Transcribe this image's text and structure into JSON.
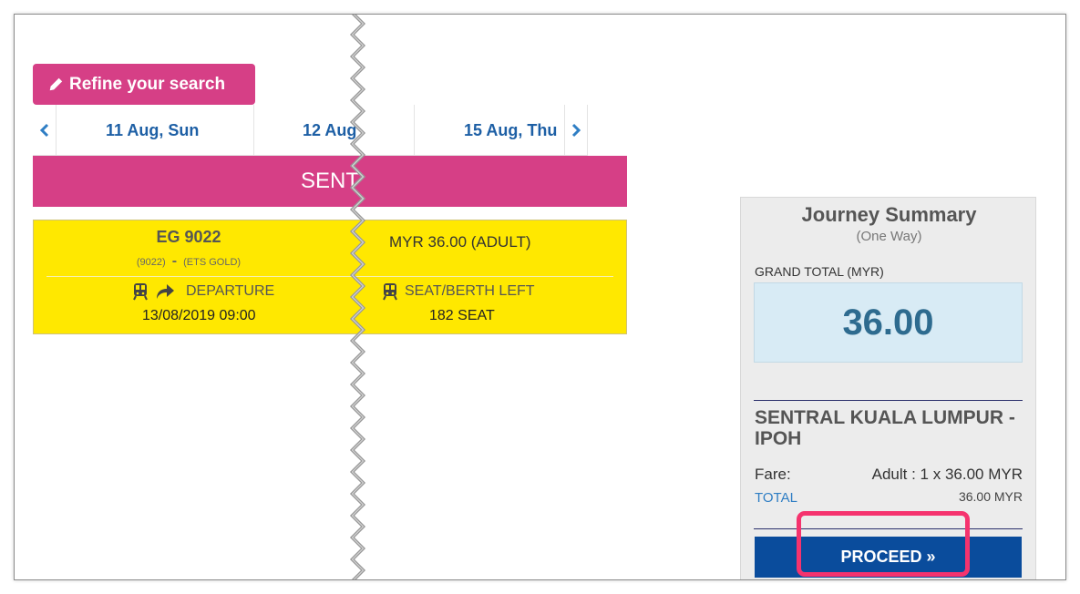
{
  "toolbar": {
    "refine_label": "Refine your search"
  },
  "date_nav": {
    "prev_icon": "chevron-left-icon",
    "next_icon": "chevron-right-icon",
    "dates": [
      "11 Aug, Sun",
      "12 Aug",
      "15 Aug, Thu"
    ]
  },
  "route_header": {
    "station": "SENT"
  },
  "train": {
    "code": "EG 9022",
    "number": "(9022)",
    "dash": "-",
    "class": "(ETS GOLD)",
    "price": "MYR 36.00 (ADULT)",
    "departure_label": "DEPARTURE",
    "departure_value": "13/08/2019 09:00",
    "seat_label": "SEAT/BERTH LEFT",
    "seat_value": "182 SEAT",
    "train_icon": "train-icon",
    "arrow_icon": "share-arrow-icon"
  },
  "summary": {
    "title": "Journey Summary",
    "subtitle": "(One Way)",
    "grand_total_label": "GRAND TOTAL (MYR)",
    "grand_total_value": "36.00",
    "route": "SENTRAL KUALA LUMPUR - IPOH",
    "fare_label": "Fare:",
    "fare_value": "Adult : 1 x 36.00 MYR",
    "total_label": "TOTAL",
    "total_value": "36.00 MYR",
    "proceed_label": "PROCEED »"
  },
  "colors": {
    "brand_pink": "#d63f86",
    "train_yellow": "#ffe800",
    "link_blue": "#1d5fa5",
    "proceed_blue": "#0a4c9c",
    "highlight": "#f5336e"
  }
}
